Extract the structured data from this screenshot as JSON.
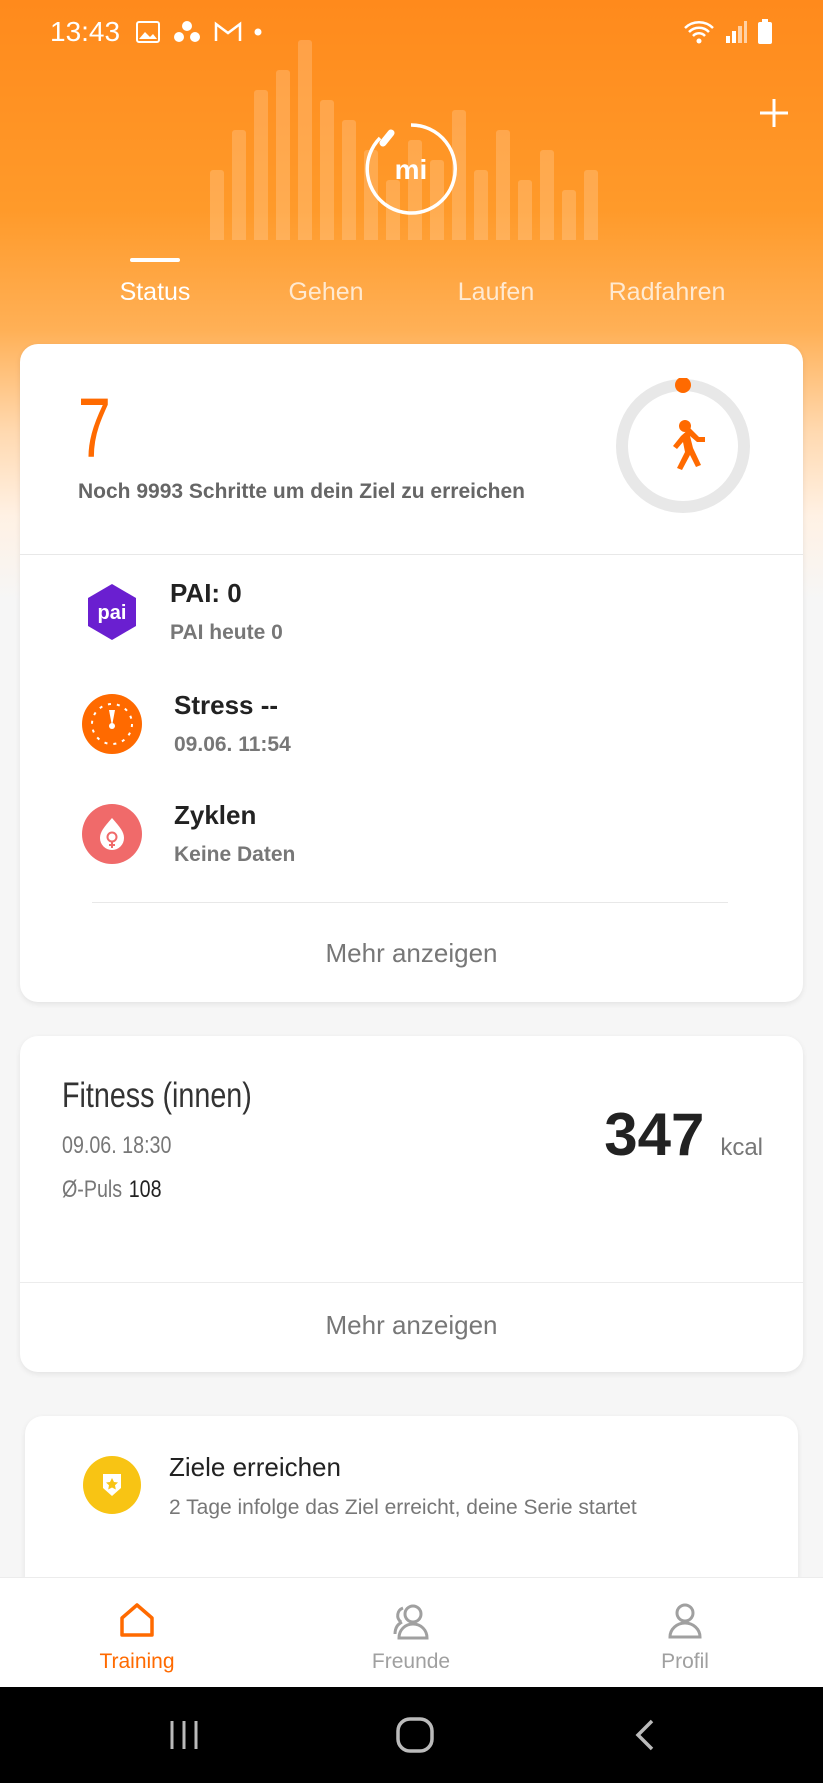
{
  "status_bar": {
    "time": "13:43"
  },
  "tabs": [
    {
      "label": "Status",
      "active": true
    },
    {
      "label": "Gehen",
      "active": false
    },
    {
      "label": "Laufen",
      "active": false
    },
    {
      "label": "Radfahren",
      "active": false
    }
  ],
  "steps": {
    "value": "7",
    "message": "Noch 9993 Schritte um dein Ziel zu erreichen",
    "goal_progress": 0.0007
  },
  "metrics": [
    {
      "title": "PAI: 0",
      "sub": "PAI heute 0",
      "icon": "pai-icon",
      "icon_text": "pai",
      "color": "#6a1fd0"
    },
    {
      "title": "Stress --",
      "sub": "09.06. 11:54",
      "icon": "stress-gauge-icon",
      "color": "#ff6a00"
    },
    {
      "title": "Zyklen",
      "sub": "Keine Daten",
      "icon": "cycle-icon",
      "color": "#f06a6a"
    }
  ],
  "status_card": {
    "more_label": "Mehr anzeigen"
  },
  "fitness": {
    "title": "Fitness (innen)",
    "date": "09.06. 18:30",
    "pulse_label": "Ø-Puls",
    "pulse_value": "108",
    "kcal_value": "347",
    "kcal_unit": "kcal",
    "more_label": "Mehr anzeigen"
  },
  "goals": {
    "title": "Ziele erreichen",
    "subtitle": "2 Tage infolge das Ziel erreicht, deine Serie startet"
  },
  "bottom_nav": [
    {
      "label": "Training",
      "icon": "home-icon",
      "active": true
    },
    {
      "label": "Freunde",
      "icon": "friends-icon",
      "active": false
    },
    {
      "label": "Profil",
      "icon": "profile-icon",
      "active": false
    }
  ],
  "colors": {
    "accent": "#ff6a00",
    "header": "#ff8a1c"
  }
}
